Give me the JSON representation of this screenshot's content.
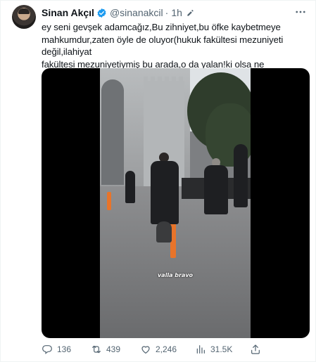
{
  "tweet": {
    "name": "Sinan Akçıl",
    "handle": "@sinanakcil",
    "separator": "·",
    "time": "1h",
    "text": "ey seni gevşek adamcağız,Bu zihniyet,bu öfke kaybetmeye\nmahkumdur,zaten öyle de oluyor(hukuk fakültesi mezuniyeti değil,ilahiyat\nfakültesi mezuniyetiymiş bu arada,o da yalan!ki olsa ne olur)ırkçılıktan\nfarklı bir söylemi yok bu videoyu çeken zavallının.",
    "video_caption": "valla bravo"
  },
  "actions": {
    "replies": "136",
    "retweets": "439",
    "likes": "2,246",
    "views": "31.5K"
  },
  "icons": {
    "verified": "verified-badge-icon",
    "edit": "edit-pencil-icon",
    "more": "more-dots-icon",
    "reply": "reply-icon",
    "retweet": "retweet-icon",
    "like": "heart-icon",
    "views": "views-chart-icon",
    "share": "share-icon"
  },
  "colors": {
    "accent": "#1d9bf0",
    "secondary_text": "#536471",
    "primary_text": "#0f1419"
  }
}
